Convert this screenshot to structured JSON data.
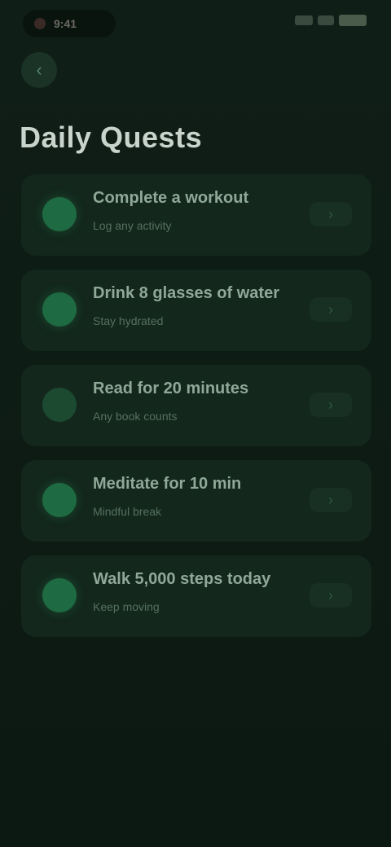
{
  "status_bar": {
    "time": "9:41"
  },
  "nav": {
    "back_glyph": "‹"
  },
  "page": {
    "title": "Daily Quests"
  },
  "quests": [
    {
      "title": "Complete a workout",
      "subtitle": "Log any activity",
      "badge": "bright",
      "action_glyph": "›"
    },
    {
      "title": "Drink 8 glasses of water",
      "subtitle": "Stay hydrated",
      "badge": "bright",
      "action_glyph": "›"
    },
    {
      "title": "Read for 20 minutes",
      "subtitle": "Any book counts",
      "badge": "dim",
      "action_glyph": "›"
    },
    {
      "title": "Meditate for 10 min",
      "subtitle": "Mindful break",
      "badge": "bright",
      "action_glyph": "›"
    },
    {
      "title": "Walk 5,000 steps today",
      "subtitle": "Keep moving",
      "badge": "bright",
      "action_glyph": "›"
    }
  ],
  "colors": {
    "background": "#0d1a14",
    "card": "#13271d",
    "accent": "#1e6a42"
  }
}
